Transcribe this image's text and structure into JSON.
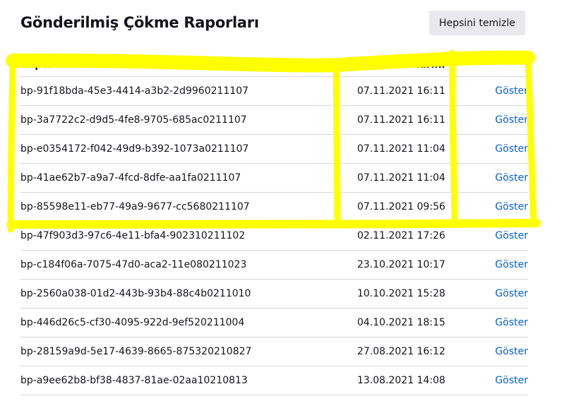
{
  "title": "Gönderilmiş Çökme Raporları",
  "clear_all_label": "Hepsini temizle",
  "columns": [
    "Rapor numarası",
    "Gönderim tarihi",
    ""
  ],
  "link_label": "Göster",
  "highlight_color": "#ffff00",
  "link_color": "#0061e0",
  "reports": [
    {
      "id": "bp-91f18bda-45e3-4414-a3b2-2d9960211107",
      "date": "07.11.2021 16:11"
    },
    {
      "id": "bp-3a7722c2-d9d5-4fe8-9705-685ac0211107",
      "date": "07.11.2021 16:11"
    },
    {
      "id": "bp-e0354172-f042-49d9-b392-1073a0211107",
      "date": "07.11.2021 11:04"
    },
    {
      "id": "bp-41ae62b7-a9a7-4fcd-8dfe-aa1fa0211107",
      "date": "07.11.2021 11:04"
    },
    {
      "id": "bp-85598e11-eb77-49a9-9677-cc5680211107",
      "date": "07.11.2021 09:56"
    },
    {
      "id": "bp-47f903d3-97c6-4e11-bfa4-902310211102",
      "date": "02.11.2021 17:26"
    },
    {
      "id": "bp-c184f06a-7075-47d0-aca2-11e080211023",
      "date": "23.10.2021 10:17"
    },
    {
      "id": "bp-2560a038-01d2-443b-93b4-88c4b0211010",
      "date": "10.10.2021 15:28"
    },
    {
      "id": "bp-446d26c5-cf30-4095-922d-9ef520211004",
      "date": "04.10.2021 18:15"
    },
    {
      "id": "bp-28159a9d-5e17-4639-8665-875320210827",
      "date": "27.08.2021 16:12"
    },
    {
      "id": "bp-a9ee62b8-bf38-4837-81ae-02aa10210813",
      "date": "13.08.2021 14:08"
    }
  ]
}
